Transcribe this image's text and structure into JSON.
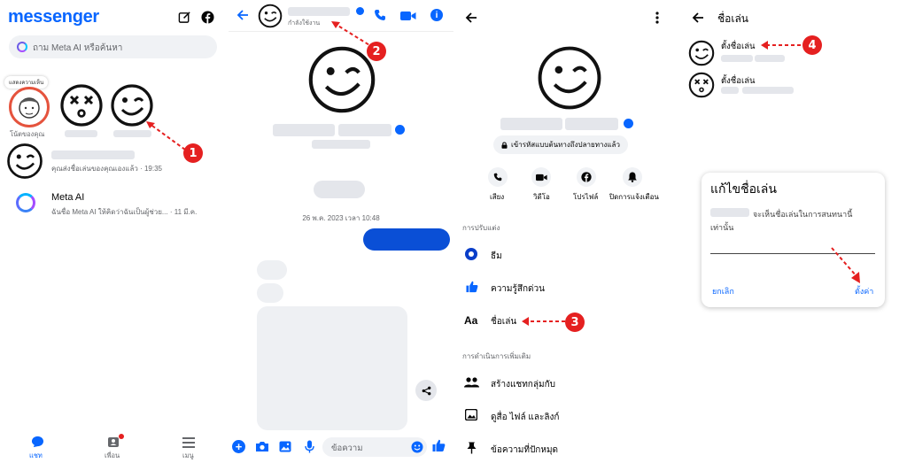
{
  "panel1": {
    "app_title": "messenger",
    "search_placeholder": "ถาม Meta AI หรือค้นหา",
    "note_bubble": "แสดงความเห็น",
    "your_note_label": "โน้ตของคุณ",
    "chat1_preview": "คุณส่งชื่อเล่นของคุณเองแล้ว · 19:35",
    "meta_ai_name": "Meta AI",
    "meta_ai_preview": "ฉันชื่อ Meta AI ให้คิดว่าฉันเป็นผู้ช่วย... · 11 มี.ค.",
    "tabs": [
      {
        "label": "แชท"
      },
      {
        "label": "เพื่อน"
      },
      {
        "label": "เมนู"
      }
    ]
  },
  "panel2": {
    "status": "กำลังใช้งาน",
    "timestamp": "26 พ.ค. 2023 เวลา 10:48",
    "composer_placeholder": "ข้อความ"
  },
  "panel3": {
    "encryption": "เข้ารหัสแบบต้นทางถึงปลายทางแล้ว",
    "actions": [
      {
        "label": "เสียง"
      },
      {
        "label": "วิดีโอ"
      },
      {
        "label": "โปรไฟล์"
      },
      {
        "label": "ปิดการแจ้งเตือน"
      }
    ],
    "section_customize": "การปรับแต่ง",
    "items_customize": [
      {
        "label": "ธีม"
      },
      {
        "label": "ความรู้สึกด่วน"
      },
      {
        "label": "ชื่อเล่น"
      }
    ],
    "aa_glyph": "Aa",
    "section_more": "การดำเนินการเพิ่มเติม",
    "items_more": [
      {
        "label": "สร้างแชทกลุ่มกับ"
      },
      {
        "label": "ดูสื่อ ไฟล์ และลิงก์"
      },
      {
        "label": "ข้อความที่ปักหมุด"
      }
    ]
  },
  "panel4": {
    "title": "ชื่อเล่น",
    "set_nickname_1": "ตั้งชื่อเล่น",
    "set_nickname_2": "ตั้งชื่อเล่น",
    "dialog_title": "แก้ไขชื่อเล่น",
    "dialog_body_line1": "จะเห็นชื่อเล่นในการสนทนานี้",
    "dialog_body_line2": "เท่านั้น",
    "cancel": "ยกเลิก",
    "confirm": "ตั้งค่า"
  },
  "markers": [
    "1",
    "2",
    "3",
    "4"
  ],
  "colors": {
    "accent_blue": "#0866ff",
    "marker_red": "#e52020",
    "gray_placeholder": "#e4e6eb"
  }
}
